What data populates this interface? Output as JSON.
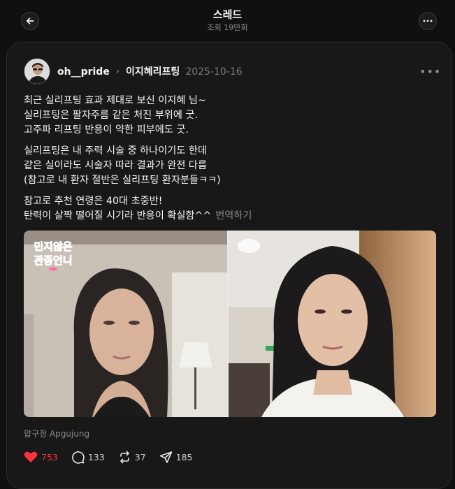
{
  "header": {
    "title": "스레드",
    "subtitle": "조회 19만회"
  },
  "post": {
    "username": "oh__pride",
    "topic": "이지혜리프팅",
    "date": "2025-10-16",
    "paragraphs": [
      [
        "최근 실리프팅 효과 제대로 보신 이지혜 님~",
        "실리프팅은 팔자주름 같은 처진 부위에 굿.",
        "고주파 리프팅 반응이 약한 피부에도 굿."
      ],
      [
        "실리프팅은 내 주력 시술 중 하나이기도 한데",
        "같은 실이라도 시술자 따라 결과가 완전 다름",
        "(참고로 내 환자 절반은 실리프팅 환자분들ㅋㅋ)"
      ],
      [
        "참고로 추천 연령은 40대 초중반!",
        "탄력이 살짝 떨어질 시기라 반응이 확실함^^"
      ]
    ],
    "translate_label": "번역하기",
    "image_logo_text": [
      "민지않은",
      "관종언니"
    ],
    "location": "압구정 Apgujung",
    "stats": {
      "likes": "753",
      "replies": "133",
      "reposts": "37",
      "shares": "185"
    }
  },
  "colors": {
    "background": "#101010",
    "card": "#181818",
    "like": "#ff3040",
    "muted": "#8a8a8a"
  }
}
